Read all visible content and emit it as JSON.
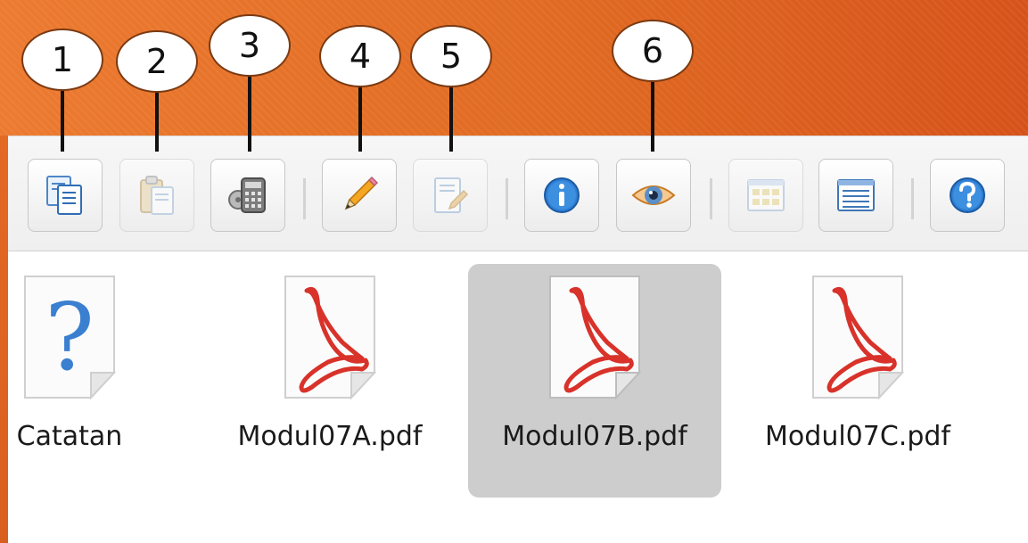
{
  "callouts": [
    "1",
    "2",
    "3",
    "4",
    "5",
    "6"
  ],
  "toolbar": {
    "buttons": [
      {
        "name": "copy-button",
        "icon": "copy-icon"
      },
      {
        "name": "paste-button",
        "icon": "paste-icon"
      },
      {
        "name": "calculator-button",
        "icon": "calculator-icon"
      },
      {
        "name": "rename-button",
        "icon": "pencil-icon"
      },
      {
        "name": "edit-button",
        "icon": "edit-document-icon"
      },
      {
        "name": "info-button",
        "icon": "info-icon"
      },
      {
        "name": "preview-button",
        "icon": "eye-icon"
      },
      {
        "name": "icon-view-button",
        "icon": "grid-view-icon"
      },
      {
        "name": "list-view-button",
        "icon": "list-view-icon"
      },
      {
        "name": "help-button",
        "icon": "help-icon"
      }
    ]
  },
  "files": [
    {
      "label": "Catatan",
      "icon": "unknown-file-icon",
      "selected": false
    },
    {
      "label": "Modul07A.pdf",
      "icon": "pdf-file-icon",
      "selected": false
    },
    {
      "label": "Modul07B.pdf",
      "icon": "pdf-file-icon",
      "selected": true
    },
    {
      "label": "Modul07C.pdf",
      "icon": "pdf-file-icon",
      "selected": false
    }
  ],
  "colors": {
    "banner": "#e06a22",
    "selection": "#cdcdcd",
    "pdf_red": "#d8322a"
  }
}
